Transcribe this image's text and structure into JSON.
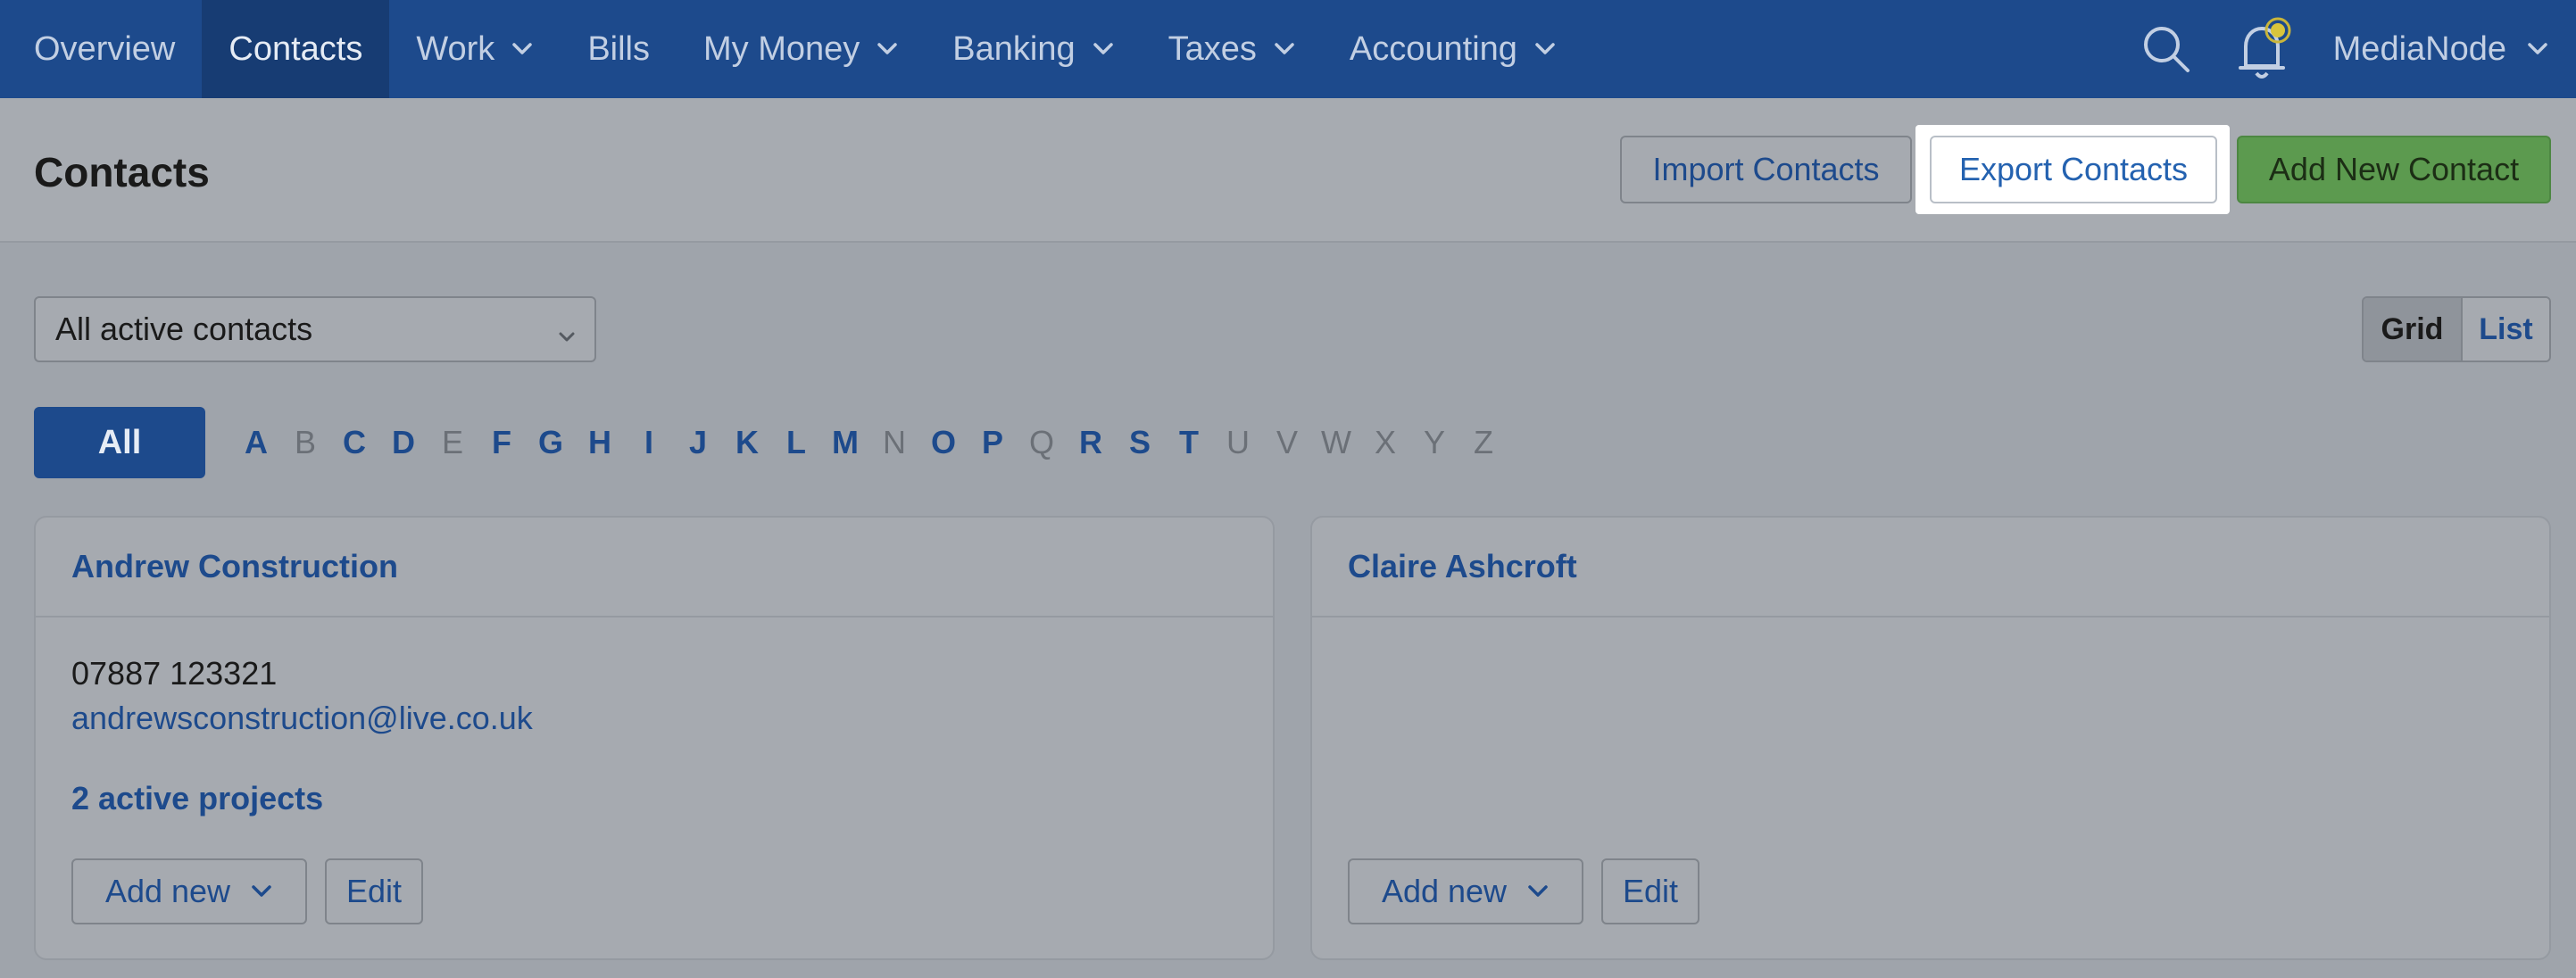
{
  "nav": {
    "items": [
      {
        "label": "Overview",
        "dropdown": false
      },
      {
        "label": "Contacts",
        "dropdown": false,
        "active": true
      },
      {
        "label": "Work",
        "dropdown": true
      },
      {
        "label": "Bills",
        "dropdown": false
      },
      {
        "label": "My Money",
        "dropdown": true
      },
      {
        "label": "Banking",
        "dropdown": true
      },
      {
        "label": "Taxes",
        "dropdown": true
      },
      {
        "label": "Accounting",
        "dropdown": true
      }
    ],
    "account": "MediaNode",
    "icons": [
      "search-icon",
      "bell-icon",
      "chevron-down-icon"
    ]
  },
  "header": {
    "title": "Contacts",
    "import_label": "Import Contacts",
    "export_label": "Export Contacts",
    "add_label": "Add New Contact"
  },
  "filter": {
    "selected": "All active contacts",
    "view_grid": "Grid",
    "view_list": "List",
    "active_view": "Grid"
  },
  "alphabet": {
    "all_label": "All",
    "letters": [
      {
        "l": "A",
        "on": true
      },
      {
        "l": "B",
        "on": false
      },
      {
        "l": "C",
        "on": true
      },
      {
        "l": "D",
        "on": true
      },
      {
        "l": "E",
        "on": false
      },
      {
        "l": "F",
        "on": true
      },
      {
        "l": "G",
        "on": true
      },
      {
        "l": "H",
        "on": true
      },
      {
        "l": "I",
        "on": true
      },
      {
        "l": "J",
        "on": true
      },
      {
        "l": "K",
        "on": true
      },
      {
        "l": "L",
        "on": true
      },
      {
        "l": "M",
        "on": true
      },
      {
        "l": "N",
        "on": false
      },
      {
        "l": "O",
        "on": true
      },
      {
        "l": "P",
        "on": true
      },
      {
        "l": "Q",
        "on": false
      },
      {
        "l": "R",
        "on": true
      },
      {
        "l": "S",
        "on": true
      },
      {
        "l": "T",
        "on": true
      },
      {
        "l": "U",
        "on": false
      },
      {
        "l": "V",
        "on": false
      },
      {
        "l": "W",
        "on": false
      },
      {
        "l": "X",
        "on": false
      },
      {
        "l": "Y",
        "on": false
      },
      {
        "l": "Z",
        "on": false
      }
    ]
  },
  "cards": [
    {
      "name": "Andrew Construction",
      "phone": "07887 123321",
      "email": "andrewsconstruction@live.co.uk",
      "projects": "2 active projects",
      "add_new": "Add new",
      "edit": "Edit"
    },
    {
      "name": "Claire Ashcroft",
      "phone": "",
      "email": "",
      "projects": "",
      "add_new": "Add new",
      "edit": "Edit"
    }
  ],
  "colors": {
    "nav_bg": "#1d4a8c",
    "accent": "#2462b0",
    "add_button": "#5c9a4f",
    "overlay_bg": "#9fa4ab"
  }
}
